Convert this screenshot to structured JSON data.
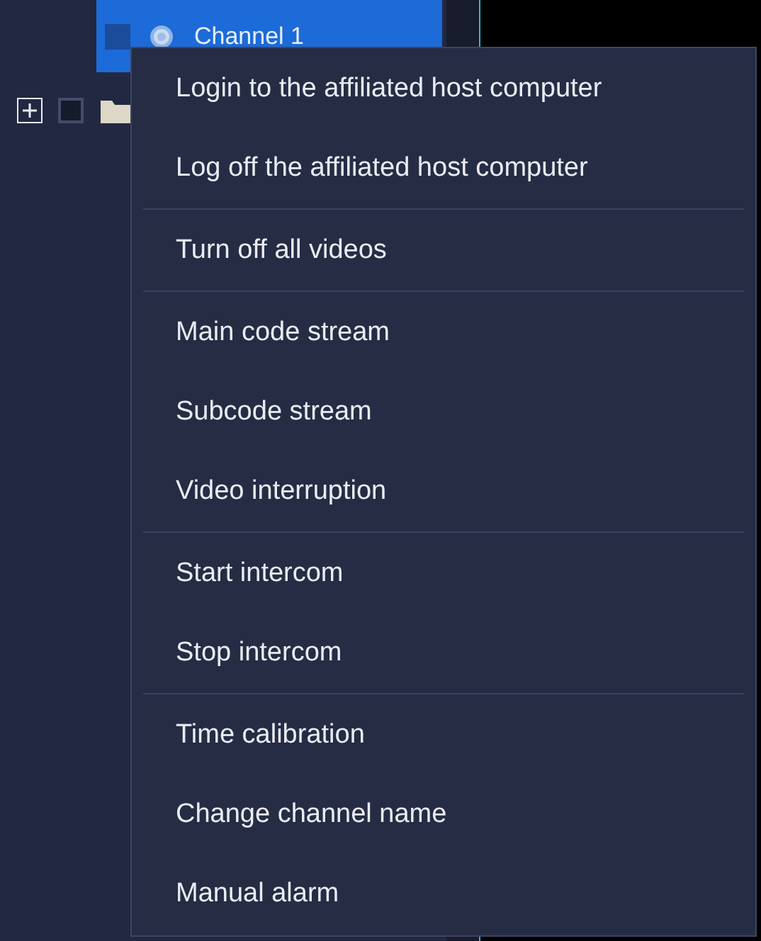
{
  "tree": [
    {
      "kind": "channel",
      "label": "Channel 1",
      "selected": true,
      "checked": false
    },
    {
      "kind": "folder",
      "expanded": false,
      "checked": false
    }
  ],
  "context_menu": {
    "groups": [
      [
        "Login to the affiliated host computer",
        "Log off the affiliated host computer"
      ],
      [
        "Turn off all videos"
      ],
      [
        "Main code stream",
        "Subcode stream",
        "Video interruption"
      ],
      [
        "Start intercom",
        "Stop intercom"
      ],
      [
        "Time calibration",
        "Change channel name",
        "Manual alarm"
      ]
    ]
  }
}
